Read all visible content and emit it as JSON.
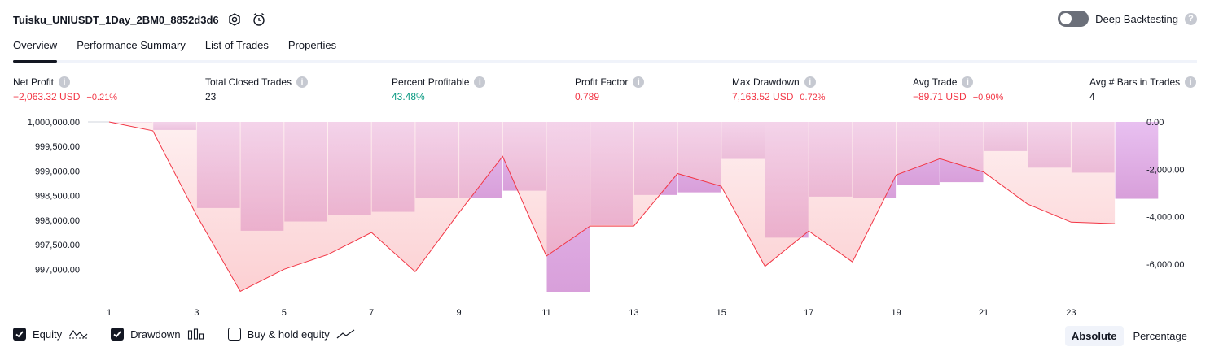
{
  "header": {
    "title": "Tuisku_UNIUSDT_1Day_2BM0_8852d3d6",
    "settings_icon": "settings-gear-icon",
    "alert_icon": "alarm-clock-plus-icon"
  },
  "deep_backtesting": {
    "label": "Deep Backtesting",
    "enabled": false,
    "help_icon": "question-icon"
  },
  "tabs": [
    {
      "label": "Overview",
      "active": true
    },
    {
      "label": "Performance Summary",
      "active": false
    },
    {
      "label": "List of Trades",
      "active": false
    },
    {
      "label": "Properties",
      "active": false
    }
  ],
  "stats": [
    {
      "label": "Net Profit",
      "value": "−2,063.32 USD",
      "sub": "−0.21%",
      "tone": "neg"
    },
    {
      "label": "Total Closed Trades",
      "value": "23",
      "sub": "",
      "tone": "dark"
    },
    {
      "label": "Percent Profitable",
      "value": "43.48%",
      "sub": "",
      "tone": "pos"
    },
    {
      "label": "Profit Factor",
      "value": "0.789",
      "sub": "",
      "tone": "neg"
    },
    {
      "label": "Max Drawdown",
      "value": "7,163.52 USD",
      "sub": "0.72%",
      "tone": "neg"
    },
    {
      "label": "Avg Trade",
      "value": "−89.71 USD",
      "sub": "−0.90%",
      "tone": "neg"
    },
    {
      "label": "Avg # Bars in Trades",
      "value": "4",
      "sub": "",
      "tone": "dark"
    }
  ],
  "chart_data": {
    "type": "line",
    "x_ticks": [
      "1",
      "3",
      "5",
      "7",
      "9",
      "11",
      "13",
      "15",
      "17",
      "19",
      "21",
      "23"
    ],
    "x": [
      1,
      2,
      3,
      4,
      5,
      6,
      7,
      8,
      9,
      10,
      11,
      12,
      13,
      14,
      15,
      16,
      17,
      18,
      19,
      20,
      21,
      22,
      23,
      24
    ],
    "left_axis": {
      "ticks": [
        "1,000,000.00",
        "999,500.00",
        "999,000.00",
        "998,500.00",
        "998,000.00",
        "997,500.00",
        "997,000.00"
      ],
      "ylim": [
        996550,
        1000000
      ]
    },
    "right_axis": {
      "ticks": [
        "0.00",
        "-2,000.00",
        "-4,000.00",
        "-6,000.00"
      ],
      "ylim": [
        -7163.52,
        0
      ]
    },
    "series": [
      {
        "name": "Equity",
        "axis": "left",
        "color": "#f23645",
        "values": [
          1000000,
          999820,
          998100,
          996550,
          997000,
          997300,
          997750,
          996950,
          998150,
          999300,
          997270,
          997880,
          997880,
          998950,
          998690,
          997060,
          997780,
          997150,
          998920,
          999250,
          998980,
          998330,
          997960,
          997930
        ]
      },
      {
        "name": "Drawdown",
        "axis": "right",
        "color": "#cc8ef0",
        "values": [
          0,
          -340,
          -3630,
          -4590,
          -4200,
          -3930,
          -3790,
          -3200,
          -3200,
          -2900,
          -7163.52,
          -4350,
          -3080,
          -2970,
          -1560,
          -4880,
          -3150,
          -3200,
          -2650,
          -2540,
          -1230,
          -1930,
          -2140,
          -3240
        ]
      }
    ]
  },
  "legend": [
    {
      "label": "Equity",
      "checked": true,
      "icon": "equity-line-icon"
    },
    {
      "label": "Drawdown",
      "checked": true,
      "icon": "drawdown-bars-icon"
    },
    {
      "label": "Buy & hold equity",
      "checked": false,
      "icon": "buy-hold-line-icon"
    }
  ],
  "modes": [
    {
      "label": "Absolute",
      "active": true
    },
    {
      "label": "Percentage",
      "active": false
    }
  ]
}
